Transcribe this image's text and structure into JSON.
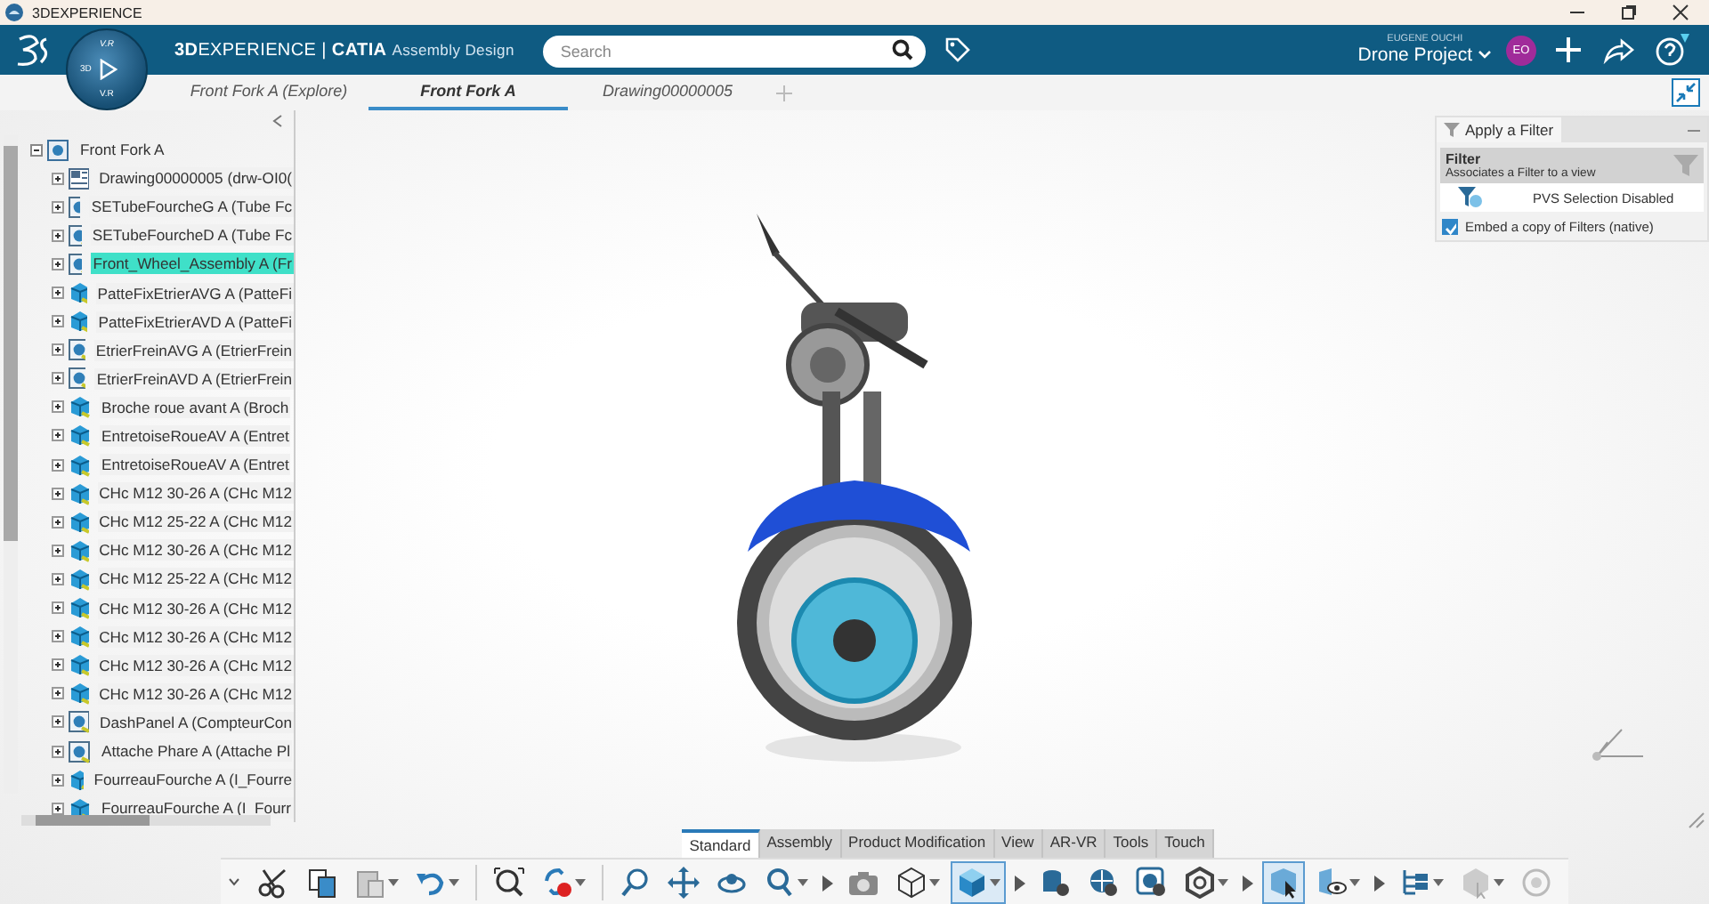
{
  "window": {
    "title": "3DEXPERIENCE"
  },
  "header": {
    "brand_bold": "3D",
    "brand": "EXPERIENCE",
    "separator": "|",
    "app_bold": "CATIA",
    "app": "Assembly Design",
    "search": {
      "placeholder": "Search"
    },
    "compass": {
      "top": "V.R",
      "left": "3D",
      "bottom": "V.R"
    },
    "user": "EUGENE OUCHI",
    "project": "Drone Project",
    "avatar": "EO"
  },
  "tabs": [
    {
      "label": "Front Fork A (Explore)",
      "selected": false
    },
    {
      "label": "Front Fork A",
      "selected": true
    },
    {
      "label": "Drawing00000005",
      "selected": false
    }
  ],
  "tree": {
    "label": "Front Fork A",
    "expanded": true,
    "children": [
      {
        "label": "Drawing00000005 (drw-OI0(",
        "kind": "drawing",
        "selected": false,
        "expanded": false
      },
      {
        "label": "SETubeFourcheG A (Tube Fc",
        "kind": "product",
        "selected": false,
        "expanded": false
      },
      {
        "label": "SETubeFourcheD A (Tube Fc",
        "kind": "product",
        "selected": false,
        "expanded": false
      },
      {
        "label": "Front_Wheel_Assembly A (Fr",
        "kind": "product",
        "selected": true,
        "expanded": false
      },
      {
        "label": "PatteFixEtrierAVG A (PatteFi",
        "kind": "part",
        "selected": false,
        "expanded": false
      },
      {
        "label": "PatteFixEtrierAVD A (PatteFi",
        "kind": "part",
        "selected": false,
        "expanded": false
      },
      {
        "label": "EtrierFreinAVG A (EtrierFrein",
        "kind": "product",
        "selected": false,
        "expanded": false
      },
      {
        "label": "EtrierFreinAVD A (EtrierFrein",
        "kind": "product",
        "selected": false,
        "expanded": false
      },
      {
        "label": "Broche roue avant A (Broch",
        "kind": "part",
        "selected": false,
        "expanded": false
      },
      {
        "label": "EntretoiseRoueAV A (Entret",
        "kind": "part",
        "selected": false,
        "expanded": false
      },
      {
        "label": "EntretoiseRoueAV A (Entret",
        "kind": "part",
        "selected": false,
        "expanded": false
      },
      {
        "label": "CHc M12 30-26 A (CHc M12",
        "kind": "part",
        "selected": false,
        "expanded": false
      },
      {
        "label": "CHc M12 25-22 A (CHc M12",
        "kind": "part",
        "selected": false,
        "expanded": false
      },
      {
        "label": "CHc M12 30-26 A (CHc M12",
        "kind": "part",
        "selected": false,
        "expanded": false
      },
      {
        "label": "CHc M12 25-22 A (CHc M12",
        "kind": "part",
        "selected": false,
        "expanded": false
      },
      {
        "label": "CHc M12 30-26 A (CHc M12",
        "kind": "part",
        "selected": false,
        "expanded": false
      },
      {
        "label": "CHc M12 30-26 A (CHc M12",
        "kind": "part",
        "selected": false,
        "expanded": false
      },
      {
        "label": "CHc M12 30-26 A (CHc M12",
        "kind": "part",
        "selected": false,
        "expanded": false
      },
      {
        "label": "CHc M12 30-26 A (CHc M12",
        "kind": "part",
        "selected": false,
        "expanded": false
      },
      {
        "label": "DashPanel A (CompteurCon",
        "kind": "product",
        "selected": false,
        "expanded": false
      },
      {
        "label": "Attache Phare A (Attache Pl",
        "kind": "product",
        "selected": false,
        "expanded": false
      },
      {
        "label": "FourreauFourche A (I_Fourre",
        "kind": "part",
        "selected": false,
        "expanded": false
      },
      {
        "label": "FourreauFourche A (I_Fourr",
        "kind": "part",
        "selected": false,
        "expanded": false
      }
    ]
  },
  "filter_panel": {
    "title": "Apply a Filter",
    "heading": "Filter",
    "description": "Associates a Filter to a view",
    "status": "PVS Selection Disabled",
    "embed": {
      "label": "Embed a copy of Filters (native)",
      "checked": true
    }
  },
  "workbench_tabs": [
    {
      "label": "Standard",
      "selected": true
    },
    {
      "label": "Assembly",
      "selected": false
    },
    {
      "label": "Product Modification",
      "selected": false
    },
    {
      "label": "View",
      "selected": false
    },
    {
      "label": "AR-VR",
      "selected": false
    },
    {
      "label": "Tools",
      "selected": false
    },
    {
      "label": "Touch",
      "selected": false
    }
  ],
  "toolbar": [
    {
      "kind": "cut",
      "selected": false,
      "dropdown": false
    },
    {
      "kind": "copy",
      "selected": false,
      "dropdown": false
    },
    {
      "kind": "paste",
      "selected": false,
      "dropdown": true
    },
    {
      "kind": "undo",
      "selected": false,
      "dropdown": true
    },
    {
      "kind": "sep"
    },
    {
      "kind": "zoom-fit",
      "selected": false,
      "dropdown": false
    },
    {
      "kind": "refresh",
      "selected": false,
      "dropdown": true
    },
    {
      "kind": "sep"
    },
    {
      "kind": "zoom",
      "selected": false,
      "dropdown": false
    },
    {
      "kind": "pan",
      "selected": false,
      "dropdown": false
    },
    {
      "kind": "rotate",
      "selected": false,
      "dropdown": false
    },
    {
      "kind": "search",
      "selected": false,
      "dropdown": true
    },
    {
      "kind": "more"
    },
    {
      "kind": "camera",
      "selected": false,
      "dropdown": false
    },
    {
      "kind": "wireframe",
      "selected": false,
      "dropdown": true
    },
    {
      "kind": "cube",
      "selected": true,
      "dropdown": true
    },
    {
      "kind": "more"
    },
    {
      "kind": "database",
      "selected": false,
      "dropdown": false
    },
    {
      "kind": "globe",
      "selected": false,
      "dropdown": false
    },
    {
      "kind": "render",
      "selected": false,
      "dropdown": false
    },
    {
      "kind": "hexagon",
      "selected": false,
      "dropdown": true
    },
    {
      "kind": "more"
    },
    {
      "kind": "select",
      "selected": true,
      "dropdown": false
    },
    {
      "kind": "visibility",
      "selected": false,
      "dropdown": true
    },
    {
      "kind": "more"
    },
    {
      "kind": "tree",
      "selected": false,
      "dropdown": true
    },
    {
      "kind": "box",
      "selected": false,
      "dropdown": true
    },
    {
      "kind": "circle",
      "selected": false,
      "dropdown": false
    }
  ]
}
